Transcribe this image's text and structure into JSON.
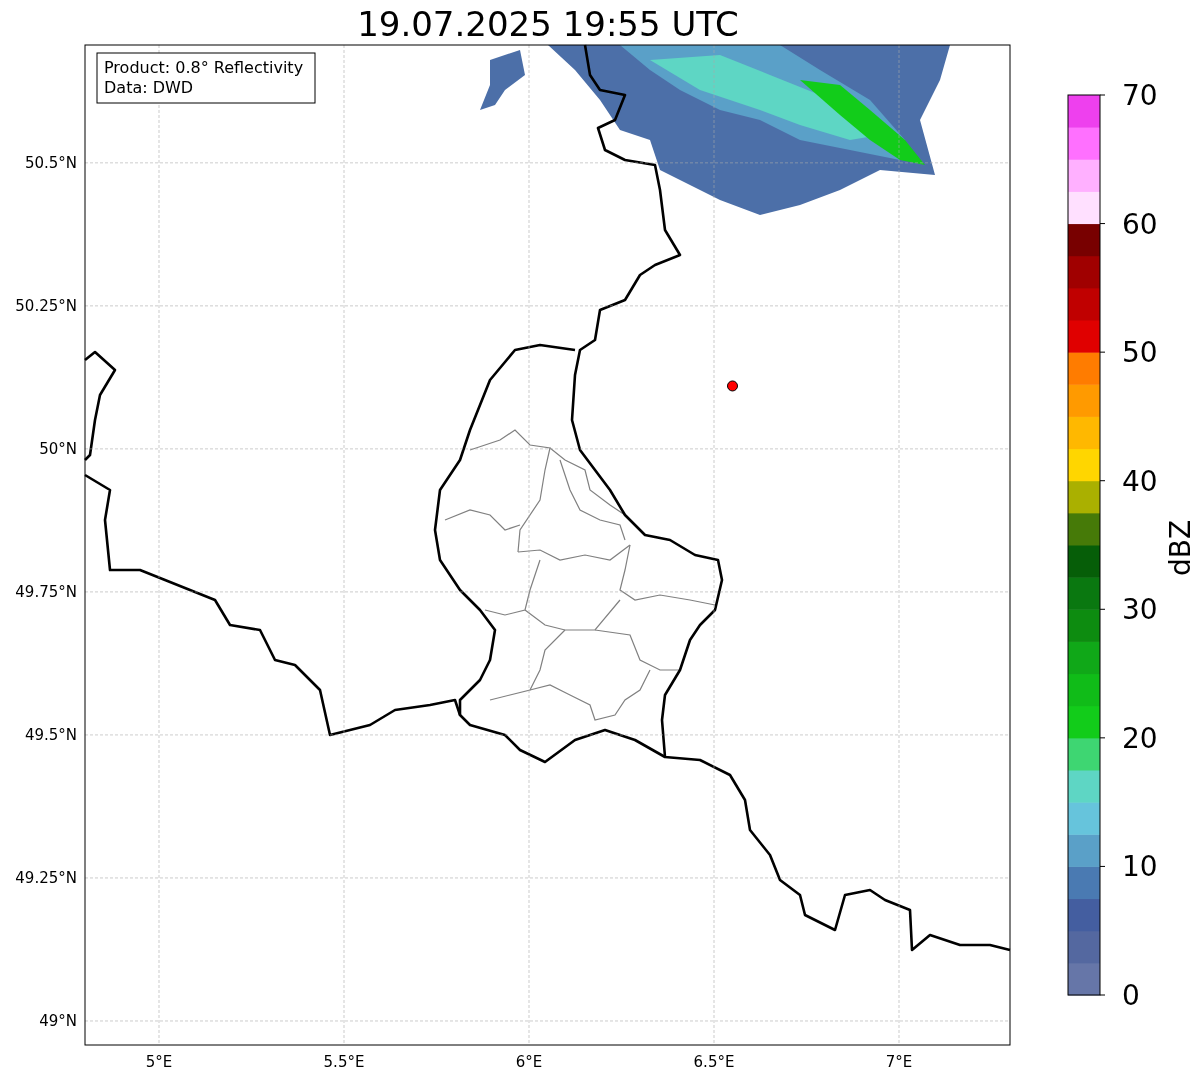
{
  "map": {
    "info_box": [
      "Product: 0.8° Reflectivity",
      "Data: DWD"
    ],
    "chart_data": {
      "type": "scatter",
      "title": "19.07.2025 19:55 UTC",
      "x": [
        6.55
      ],
      "grid": true,
      "series": [
        {
          "color": "#ff0000",
          "values": [
            50.11
          ]
        }
      ],
      "xlim": [
        4.8,
        7.3
      ],
      "ylim": [
        48.958,
        50.706
      ],
      "xticks": [
        {
          "value": 5,
          "label": "5°E"
        },
        {
          "value": 5.5,
          "label": "5.5°E"
        },
        {
          "value": 6,
          "label": "6°E"
        },
        {
          "value": 6.5,
          "label": "6.5°E"
        },
        {
          "value": 7,
          "label": "7°E"
        }
      ],
      "yticks": [
        {
          "value": 49,
          "label": "49°N"
        },
        {
          "value": 49.25,
          "label": "49.25°N"
        },
        {
          "value": 49.5,
          "label": "49.5°N"
        },
        {
          "value": 49.75,
          "label": "49.75°N"
        },
        {
          "value": 50,
          "label": "50°N"
        },
        {
          "value": 50.25,
          "label": "50.25°N"
        },
        {
          "value": 50.5,
          "label": "50.5°N"
        }
      ]
    }
  },
  "colorbar": {
    "label": "dBZ",
    "ticks": [
      "70",
      "60",
      "50",
      "40",
      "30",
      "20",
      "10",
      "0"
    ],
    "segments": [
      {
        "color": "#6676a8"
      },
      {
        "color": "#5468a0"
      },
      {
        "color": "#445ea0"
      },
      {
        "color": "#4a7ab2"
      },
      {
        "color": "#5aa0c8"
      },
      {
        "color": "#66c4dc"
      },
      {
        "color": "#5ed6c4"
      },
      {
        "color": "#3ed672"
      },
      {
        "color": "#12cc1a"
      },
      {
        "color": "#10bc18"
      },
      {
        "color": "#10a818"
      },
      {
        "color": "#0d8c10"
      },
      {
        "color": "#0a7810"
      },
      {
        "color": "#065e08"
      },
      {
        "color": "#467a08"
      },
      {
        "color": "#aab000"
      },
      {
        "color": "#ffd600"
      },
      {
        "color": "#ffb800"
      },
      {
        "color": "#ff9a00"
      },
      {
        "color": "#ff7c00"
      },
      {
        "color": "#e00000"
      },
      {
        "color": "#c00000"
      },
      {
        "color": "#a00000"
      },
      {
        "color": "#780000"
      },
      {
        "color": "#ffe0ff"
      },
      {
        "color": "#ffb0ff"
      },
      {
        "color": "#ff70ff"
      },
      {
        "color": "#ee40ee"
      }
    ]
  }
}
